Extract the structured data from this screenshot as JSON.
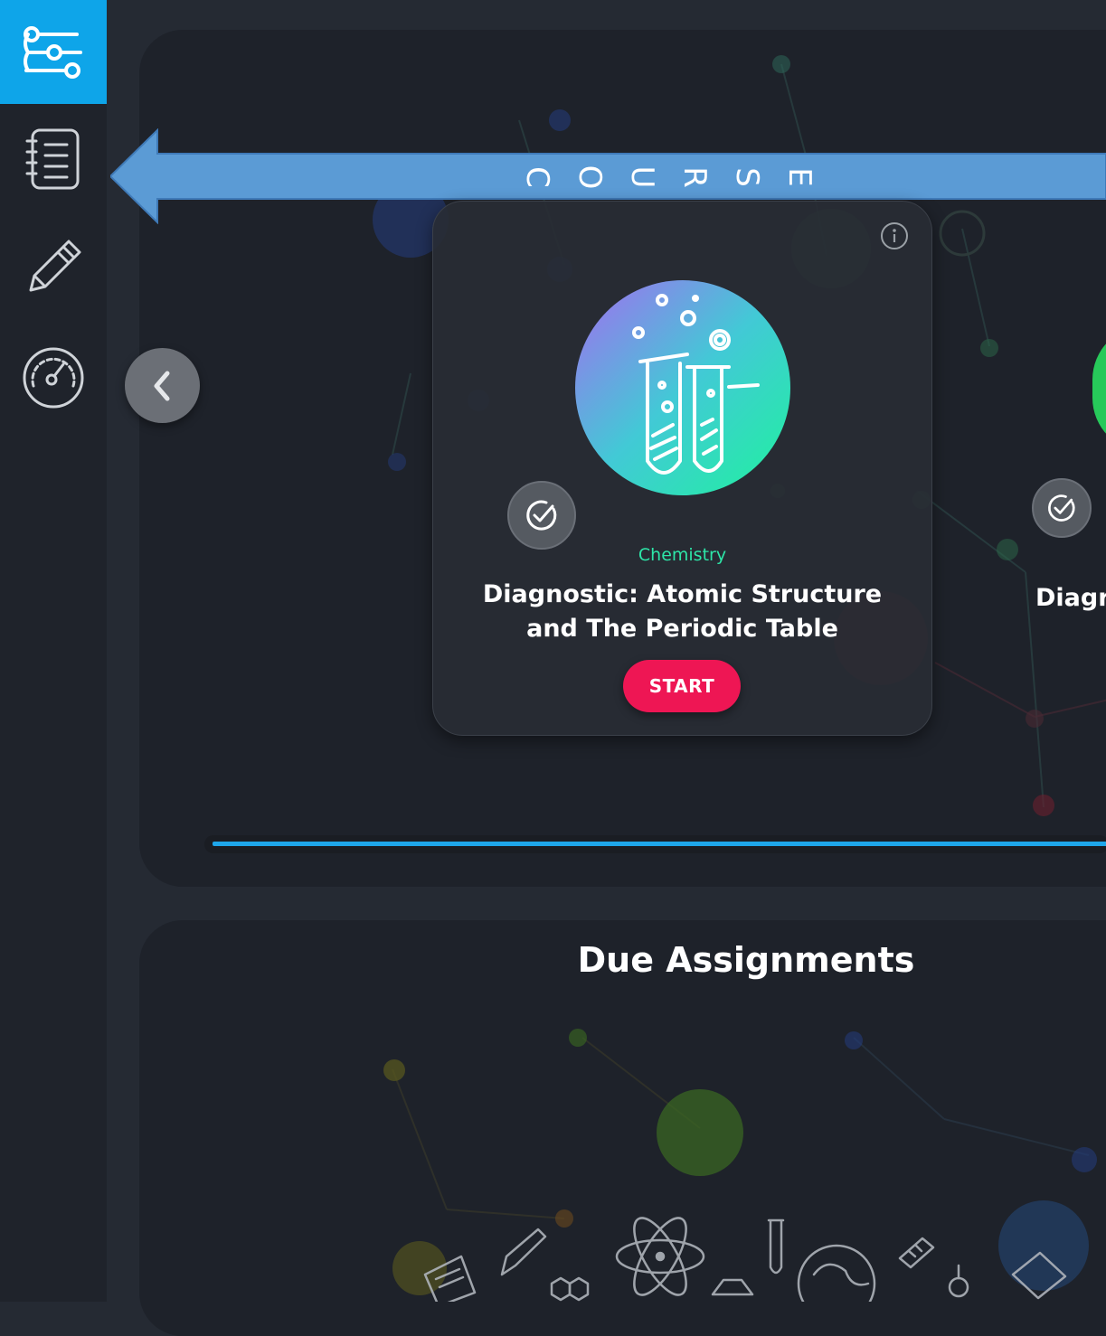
{
  "sidebar": {
    "items": [
      {
        "name": "filters-icon",
        "active": true
      },
      {
        "name": "notebook-icon",
        "active": false
      },
      {
        "name": "pencil-icon",
        "active": false
      },
      {
        "name": "gauge-icon",
        "active": false
      }
    ]
  },
  "course_arrow": {
    "letters": [
      "C",
      "O",
      "U",
      "R",
      "S",
      "E"
    ]
  },
  "carousel": {
    "cards": [
      {
        "subject": "Chemistry",
        "title": "Diagnostic: Atomic Structure and The Periodic Table",
        "action": "START"
      },
      {
        "title_partial": "Diagr"
      }
    ]
  },
  "due_assignments": {
    "title": "Due Assignments"
  },
  "colors": {
    "accent": "#0ea5e9",
    "start_button": "#ee1654",
    "subject": "#2de6a8",
    "arrow": "#5b9bd5"
  }
}
